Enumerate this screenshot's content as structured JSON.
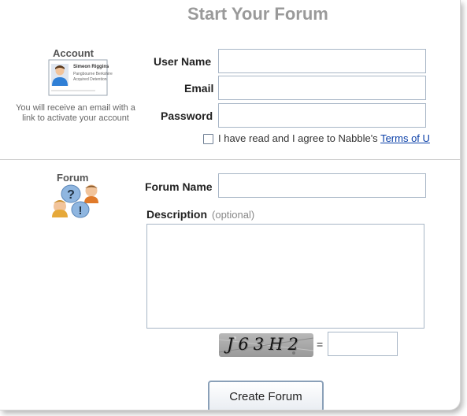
{
  "title": "Start Your Forum",
  "account": {
    "heading": "Account",
    "card_lines": [
      "Simeon Riggins",
      "Pangbourne Berkshire",
      "Acquired Detention"
    ],
    "note": "You will receive an email with a link to activate your account",
    "username_label": "User Name",
    "username_value": "",
    "email_label": "Email",
    "email_value": "",
    "password_label": "Password",
    "password_value": "",
    "agree_text": "I have read and I agree to Nabble's ",
    "terms_link": "Terms of U",
    "agree_checked": false
  },
  "forum": {
    "heading": "Forum",
    "name_label": "Forum Name",
    "name_value": "",
    "description_label": "Description",
    "description_hint": "(optional)",
    "description_value": ""
  },
  "captcha": {
    "code": "J63H2",
    "equals": "=",
    "answer_value": ""
  },
  "submit_label": "Create Forum"
}
